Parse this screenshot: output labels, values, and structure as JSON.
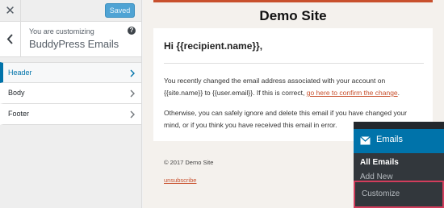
{
  "sidebar": {
    "close_icon": "close-icon",
    "save_state_label": "Saved",
    "info": {
      "subtitle": "You are customizing",
      "title": "BuddyPress Emails",
      "help_icon": "?"
    },
    "sections": [
      {
        "label": "Header",
        "active": true
      },
      {
        "label": "Body",
        "active": false
      },
      {
        "label": "Footer",
        "active": false
      }
    ]
  },
  "preview": {
    "site_title": "Demo Site",
    "greeting": "Hi {{recipient.name}},",
    "paragraph1_line1": "You recently changed the email address associated with your account on",
    "paragraph1_line2_pre": "{{site.name}} to {{user.email}}. If this is correct, ",
    "paragraph1_link": "go here to confirm the change",
    "paragraph1_line2_post": ".",
    "paragraph2_line1": "Otherwise, you can safely ignore and delete this email if you have changed your",
    "paragraph2_line2": "mind, or if you think you have received this email in error.",
    "footer_copyright": "© 2017 Demo Site",
    "unsubscribe_label": "unsubscribe"
  },
  "admin_menu": {
    "title": "Emails",
    "items": [
      "All Emails",
      "Add New",
      "Customize"
    ],
    "highlight_color": "#d13d5c"
  },
  "colors": {
    "accent": "#0073aa",
    "email_accent": "#c8502d",
    "saved_button": "#4fa3d4"
  }
}
